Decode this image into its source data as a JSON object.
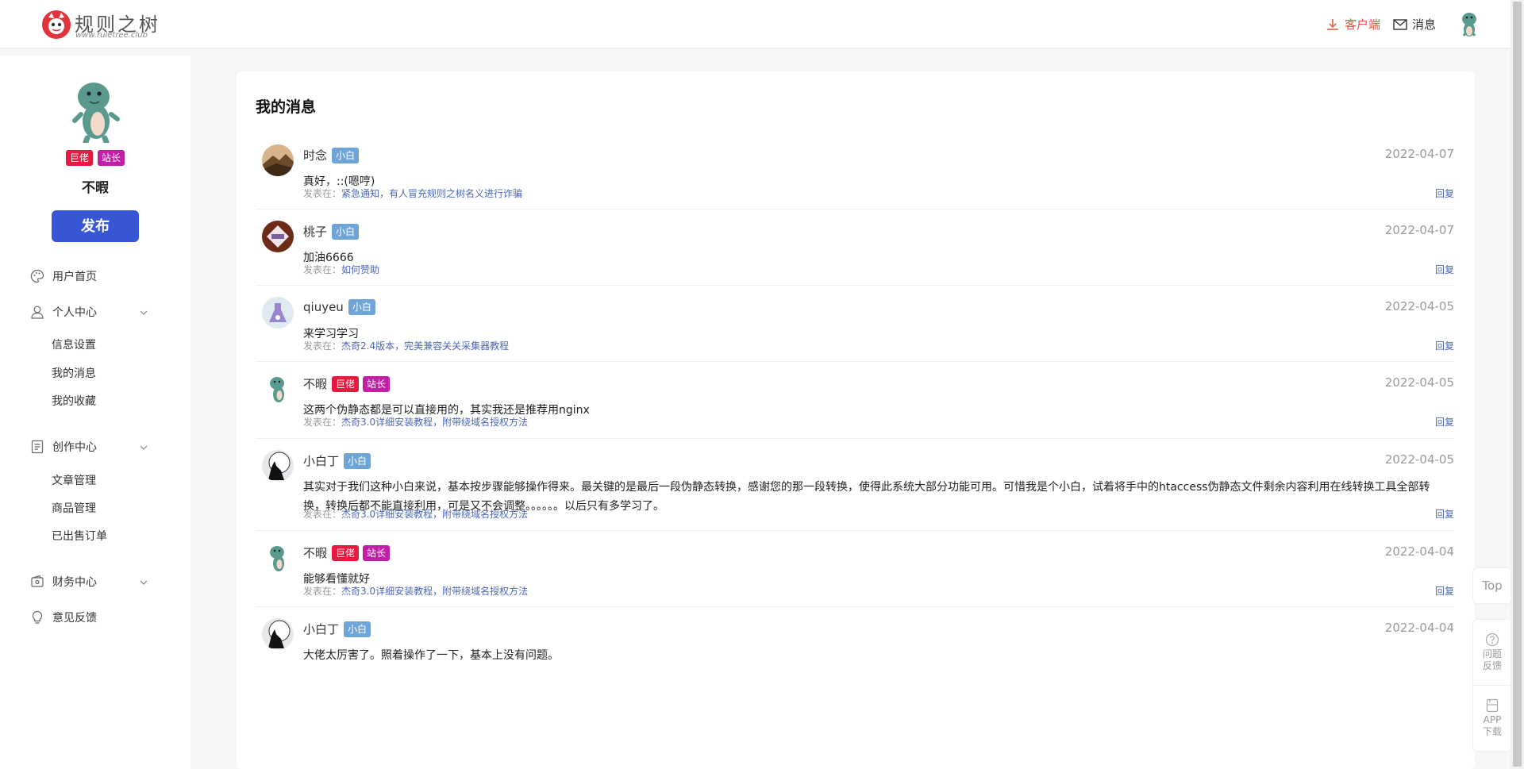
{
  "header": {
    "logo_name": "规则之树",
    "logo_url": "www.ruletree.club",
    "client_label": "客户端",
    "message_label": "消息"
  },
  "sidebar": {
    "badges": [
      "巨佬",
      "站长"
    ],
    "username": "不暇",
    "publish_label": "发布",
    "nav": [
      {
        "label": "用户首页",
        "icon": "palette-icon"
      },
      {
        "label": "个人中心",
        "icon": "user-icon",
        "children": [
          "信息设置",
          "我的消息",
          "我的收藏"
        ]
      },
      {
        "label": "创作中心",
        "icon": "document-icon",
        "children": [
          "文章管理",
          "商品管理",
          "已出售订单"
        ]
      },
      {
        "label": "财务中心",
        "icon": "wallet-icon"
      },
      {
        "label": "意见反馈",
        "icon": "lightbulb-icon"
      }
    ]
  },
  "main": {
    "title": "我的消息",
    "source_prefix": "发表在：",
    "reply_label": "回复",
    "messages": [
      {
        "name": "时念",
        "tags": [
          "小白"
        ],
        "date": "2022-04-07",
        "text": "真好，::(嗯哼)",
        "source": "紧急通知，有人冒充规则之树名义进行诈骗",
        "avatar": "mountain"
      },
      {
        "name": "桃子",
        "tags": [
          "小白"
        ],
        "date": "2022-04-07",
        "text": "加油6666",
        "source": "如何赞助",
        "avatar": "badge"
      },
      {
        "name": "qiuyeu",
        "tags": [
          "小白"
        ],
        "date": "2022-04-05",
        "text": "来学习学习",
        "source": "杰奇2.4版本，完美兼容关关采集器教程",
        "avatar": "flask"
      },
      {
        "name": "不暇",
        "tags": [
          "巨佬",
          "站长"
        ],
        "date": "2022-04-05",
        "text": "这两个伪静态都是可以直接用的，其实我还是推荐用nginx",
        "source": "杰奇3.0详细安装教程，附带绕域名授权方法",
        "avatar": "dino"
      },
      {
        "name": "小白丁",
        "tags": [
          "小白"
        ],
        "date": "2022-04-05",
        "text": "其实对于我们这种小白来说，基本按步骤能够操作得来。最关键的是最后一段伪静态转换，感谢您的那一段转换，使得此系统大部分功能可用。可惜我是个小白，试着将手中的htaccess伪静态文件剩余内容利用在线转换工具全部转换，转换后都不能直接利用，可是又不会调整。。。。。。以后只有多学习了。",
        "source": "杰奇3.0详细安装教程，附带绕域名授权方法",
        "avatar": "wolf"
      },
      {
        "name": "不暇",
        "tags": [
          "巨佬",
          "站长"
        ],
        "date": "2022-04-04",
        "text": "能够看懂就好",
        "source": "杰奇3.0详细安装教程，附带绕域名授权方法",
        "avatar": "dino"
      },
      {
        "name": "小白丁",
        "tags": [
          "小白"
        ],
        "date": "2022-04-04",
        "text": "大佬太厉害了。照着操作了一下，基本上没有问题。",
        "source": "",
        "avatar": "wolf"
      }
    ]
  },
  "floating": {
    "top_label": "Top",
    "feedback_label": "问题反馈",
    "app_label": "APP下载"
  },
  "colors": {
    "accent_blue": "#3756d6",
    "tag_red": "#e8193e",
    "tag_purple": "#c01fa6",
    "tag_blue": "#6fa4d6",
    "client_red": "#e5533d",
    "link_blue": "#4b68b8"
  }
}
